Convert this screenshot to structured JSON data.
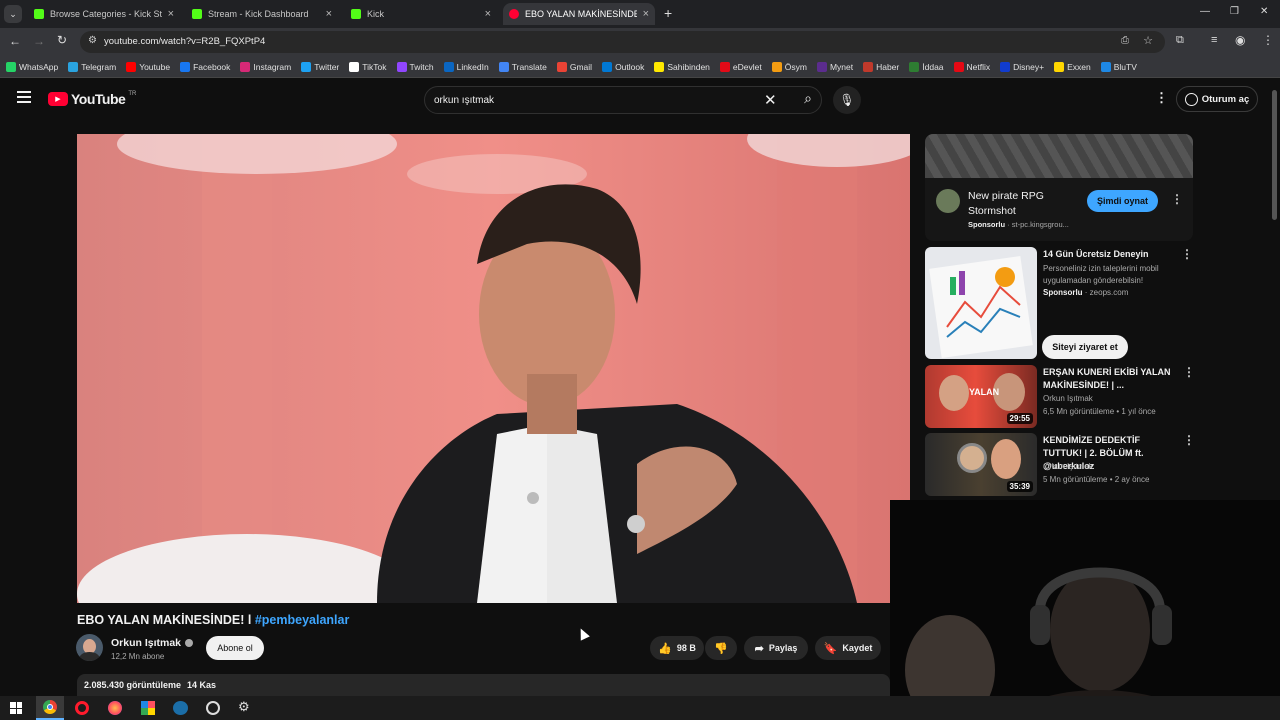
{
  "tabs": [
    {
      "title": "Browse Categories - Kick Stream",
      "color": "#53fc18"
    },
    {
      "title": "Stream - Kick Dashboard",
      "color": "#53fc18"
    },
    {
      "title": "Kick",
      "color": "#53fc18"
    },
    {
      "title": "EBO YALAN MAKİNESİNDE! l #p",
      "color": "#ff0033"
    }
  ],
  "address": {
    "url": "youtube.com/watch?v=R2B_FQXPtP4"
  },
  "bookmarks": [
    {
      "label": "WhatsApp",
      "color": "#25d366"
    },
    {
      "label": "Telegram",
      "color": "#2aa3df"
    },
    {
      "label": "Youtube",
      "color": "#ff0000"
    },
    {
      "label": "Facebook",
      "color": "#1877f2"
    },
    {
      "label": "Instagram",
      "color": "#d62976"
    },
    {
      "label": "Twitter",
      "color": "#1da1f2"
    },
    {
      "label": "TikTok",
      "color": "#ffffff"
    },
    {
      "label": "Twitch",
      "color": "#9146ff"
    },
    {
      "label": "LinkedIn",
      "color": "#0a66c2"
    },
    {
      "label": "Translate",
      "color": "#4285f4"
    },
    {
      "label": "Gmail",
      "color": "#ea4335"
    },
    {
      "label": "Outlook",
      "color": "#0078d4"
    },
    {
      "label": "Sahibinden",
      "color": "#ffe800"
    },
    {
      "label": "eDevlet",
      "color": "#e30a17"
    },
    {
      "label": "Ösym",
      "color": "#f39c12"
    },
    {
      "label": "Mynet",
      "color": "#5b2c8e"
    },
    {
      "label": "Haber",
      "color": "#c0392b"
    },
    {
      "label": "İddaa",
      "color": "#2e7d32"
    },
    {
      "label": "Netflix",
      "color": "#e50914"
    },
    {
      "label": "Disney+",
      "color": "#113ccf"
    },
    {
      "label": "Exxen",
      "color": "#ffd600"
    },
    {
      "label": "BluTV",
      "color": "#1e88e5"
    }
  ],
  "youtube": {
    "logo_text": "YouTube",
    "region": "TR",
    "search_query": "orkun ışıtmak",
    "signin_label": "Oturum aç"
  },
  "video": {
    "title_main": "EBO YALAN MAKİNESİNDE! l",
    "title_tag": "#pembeyalanlar",
    "channel": "Orkun Işıtmak",
    "subscribers": "12,2 Mn abone",
    "subscribe_label": "Abone ol",
    "likes": "98 B",
    "share_label": "Paylaş",
    "save_label": "Kaydet",
    "views": "2.085.430 görüntüleme",
    "date": "14 Kas"
  },
  "sidebar": {
    "ad1": {
      "title": "New pirate RPG Stormshot",
      "sponsor": "Sponsorlu",
      "domain": "st-pc.kingsgrou...",
      "cta": "Şimdi oynat"
    },
    "ad2": {
      "title": "14 Gün Ücretsiz Deneyin",
      "desc": "Personeliniz izin taleplerini mobil uygulamadan gönderebilsin!",
      "sponsor": "Sponsorlu",
      "domain": "zeops.com",
      "cta": "Siteyi ziyaret et"
    },
    "videos": [
      {
        "title": "ERŞAN KUNERİ EKİBİ YALAN MAKİNESİNDE! | ...",
        "channel": "Orkun Işıtmak",
        "views": "6,5 Mn görüntüleme",
        "age": "1 yıl önce",
        "duration": "29:55"
      },
      {
        "title": "KENDİMİZE DEDEKTİF TUTTUK! | 2. BÖLÜM ft. @uberkuloz",
        "channel": "Orkun Işıtmak",
        "views": "5 Mn görüntüleme",
        "age": "2 ay önce",
        "duration": "35:39"
      }
    ]
  }
}
